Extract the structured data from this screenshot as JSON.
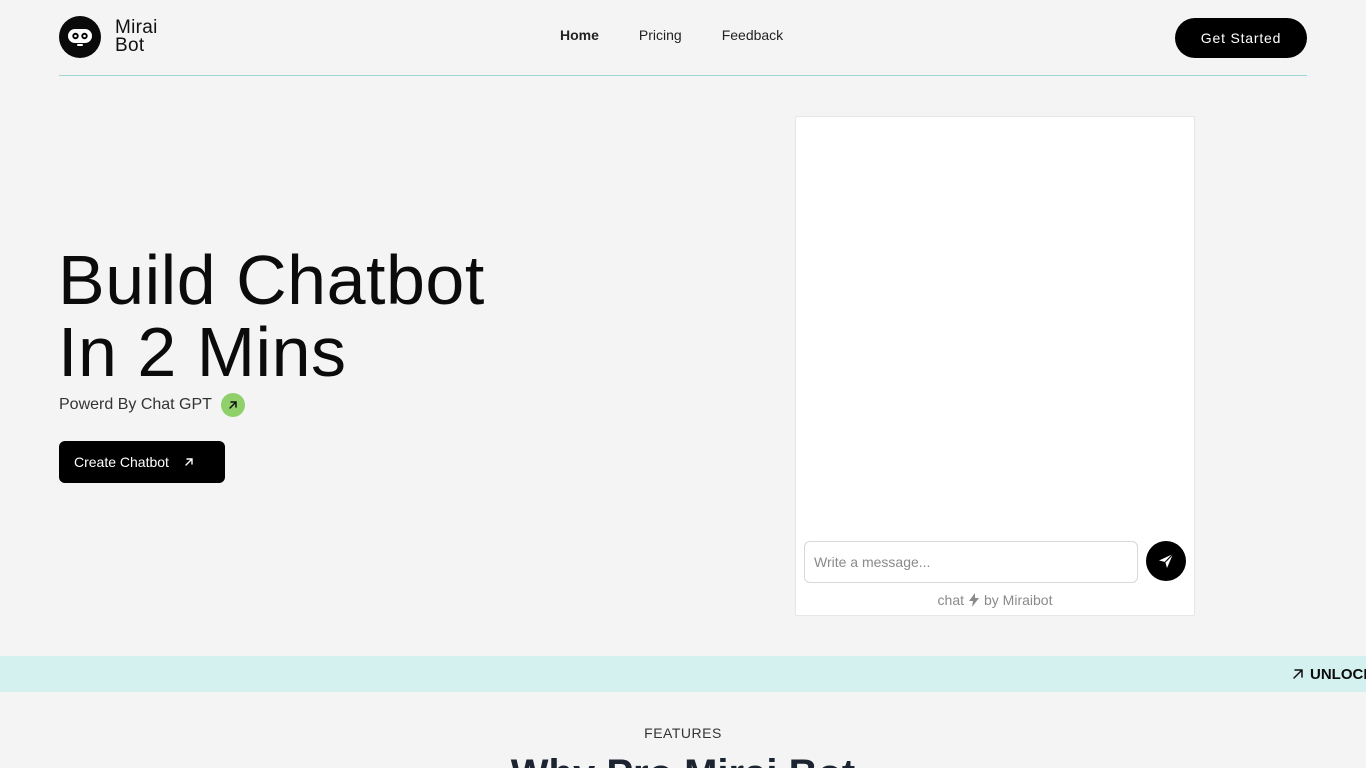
{
  "header": {
    "logo_line1": "Mirai",
    "logo_line2": "Bot",
    "logo_icon": "robot-face-icon",
    "nav": [
      {
        "label": "Home",
        "active": true
      },
      {
        "label": "Pricing",
        "active": false
      },
      {
        "label": "Feedback",
        "active": false
      }
    ],
    "cta_label": "Get Started"
  },
  "hero": {
    "title_line1": "Build Chatbot",
    "title_line2": "In 2 Mins",
    "powered_text": "Powerd By Chat GPT",
    "powered_icon": "arrow-up-right-icon",
    "create_label": "Create Chatbot",
    "create_icon": "arrow-up-right-icon"
  },
  "chat": {
    "placeholder": "Write a message...",
    "send_icon": "send-icon",
    "footer_prefix": "chat",
    "footer_icon": "lightning-icon",
    "footer_suffix": "by Miraibot"
  },
  "band": {
    "text": "UNLOCK",
    "icon": "arrow-up-right-icon"
  },
  "features": {
    "label": "FEATURES",
    "title": "Why Pro Mirai Bot"
  },
  "colors": {
    "background": "#f4f4f4",
    "primary": "#000000",
    "accent_green": "#8fd06b",
    "band": "#d5f1ef",
    "divider": "#9fd6d2"
  }
}
